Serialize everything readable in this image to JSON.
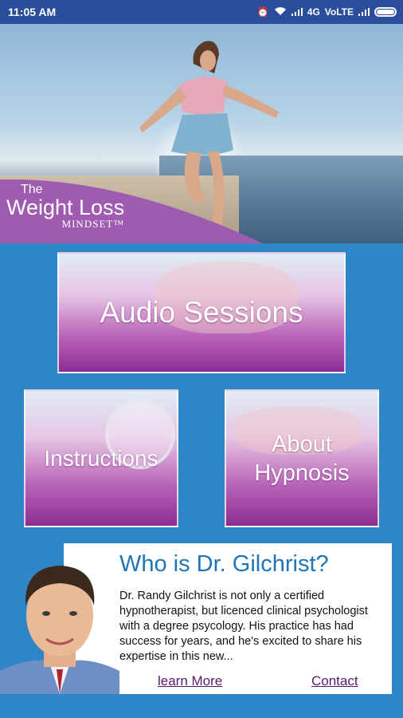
{
  "status_bar": {
    "time": "11:05 AM",
    "network": "4G",
    "carrier": "VoLTE"
  },
  "logo": {
    "the": "The",
    "weight_loss": "Weight Loss",
    "mindset": "MINDSET™"
  },
  "tiles": {
    "audio": "Audio Sessions",
    "instructions": "Instructions",
    "about_line1": "About",
    "about_line2": "Hypnosis"
  },
  "info_card": {
    "title": "Who is Dr. Gilchrist?",
    "body": "Dr. Randy Gilchrist is not only a certified hypnotherapist, but licenced clinical psychologist with a degree psycology. His practice has had success for years, and he's excited to share his expertise in this new...",
    "learn_more": "learn More",
    "contact": "Contact"
  },
  "colors": {
    "status_bar": "#2a4e9c",
    "background": "#2f86c6",
    "tile_purple": "#8c2c93",
    "title_blue": "#1f75b5",
    "link_purple": "#5a1a6e"
  }
}
